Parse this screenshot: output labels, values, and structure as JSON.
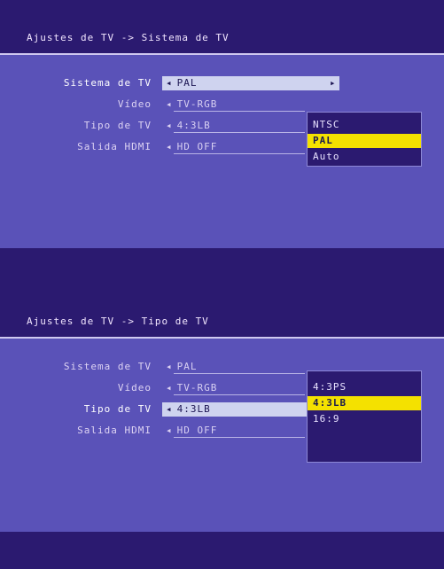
{
  "screen1": {
    "title": "Ajustes de TV -> Sistema de TV",
    "rows": [
      {
        "label": "Sistema de TV",
        "value": "PAL"
      },
      {
        "label": "Vídeo",
        "value": "TV-RGB"
      },
      {
        "label": "Tipo de TV",
        "value": "4:3LB"
      },
      {
        "label": "Salida HDMI",
        "value": "HD OFF"
      }
    ],
    "dropdown": {
      "options": [
        "NTSC",
        "PAL",
        "Auto"
      ],
      "selected": "PAL"
    }
  },
  "screen2": {
    "title": "Ajustes de TV -> Tipo de TV",
    "rows": [
      {
        "label": "Sistema de TV",
        "value": "PAL"
      },
      {
        "label": "Vídeo",
        "value": "TV-RGB"
      },
      {
        "label": "Tipo de TV",
        "value": "4:3LB"
      },
      {
        "label": "Salida HDMI",
        "value": "HD OFF"
      }
    ],
    "dropdown": {
      "options": [
        "4:3PS",
        "4:3LB",
        "16:9"
      ],
      "selected": "4:3LB"
    }
  },
  "icons": {
    "left_arrow": "◂",
    "right_arrow": "▸"
  },
  "colors": {
    "background": "#2b1a70",
    "panel": "#5a52b8",
    "highlight": "#f4e100",
    "selected_row": "#cfd3ef"
  }
}
